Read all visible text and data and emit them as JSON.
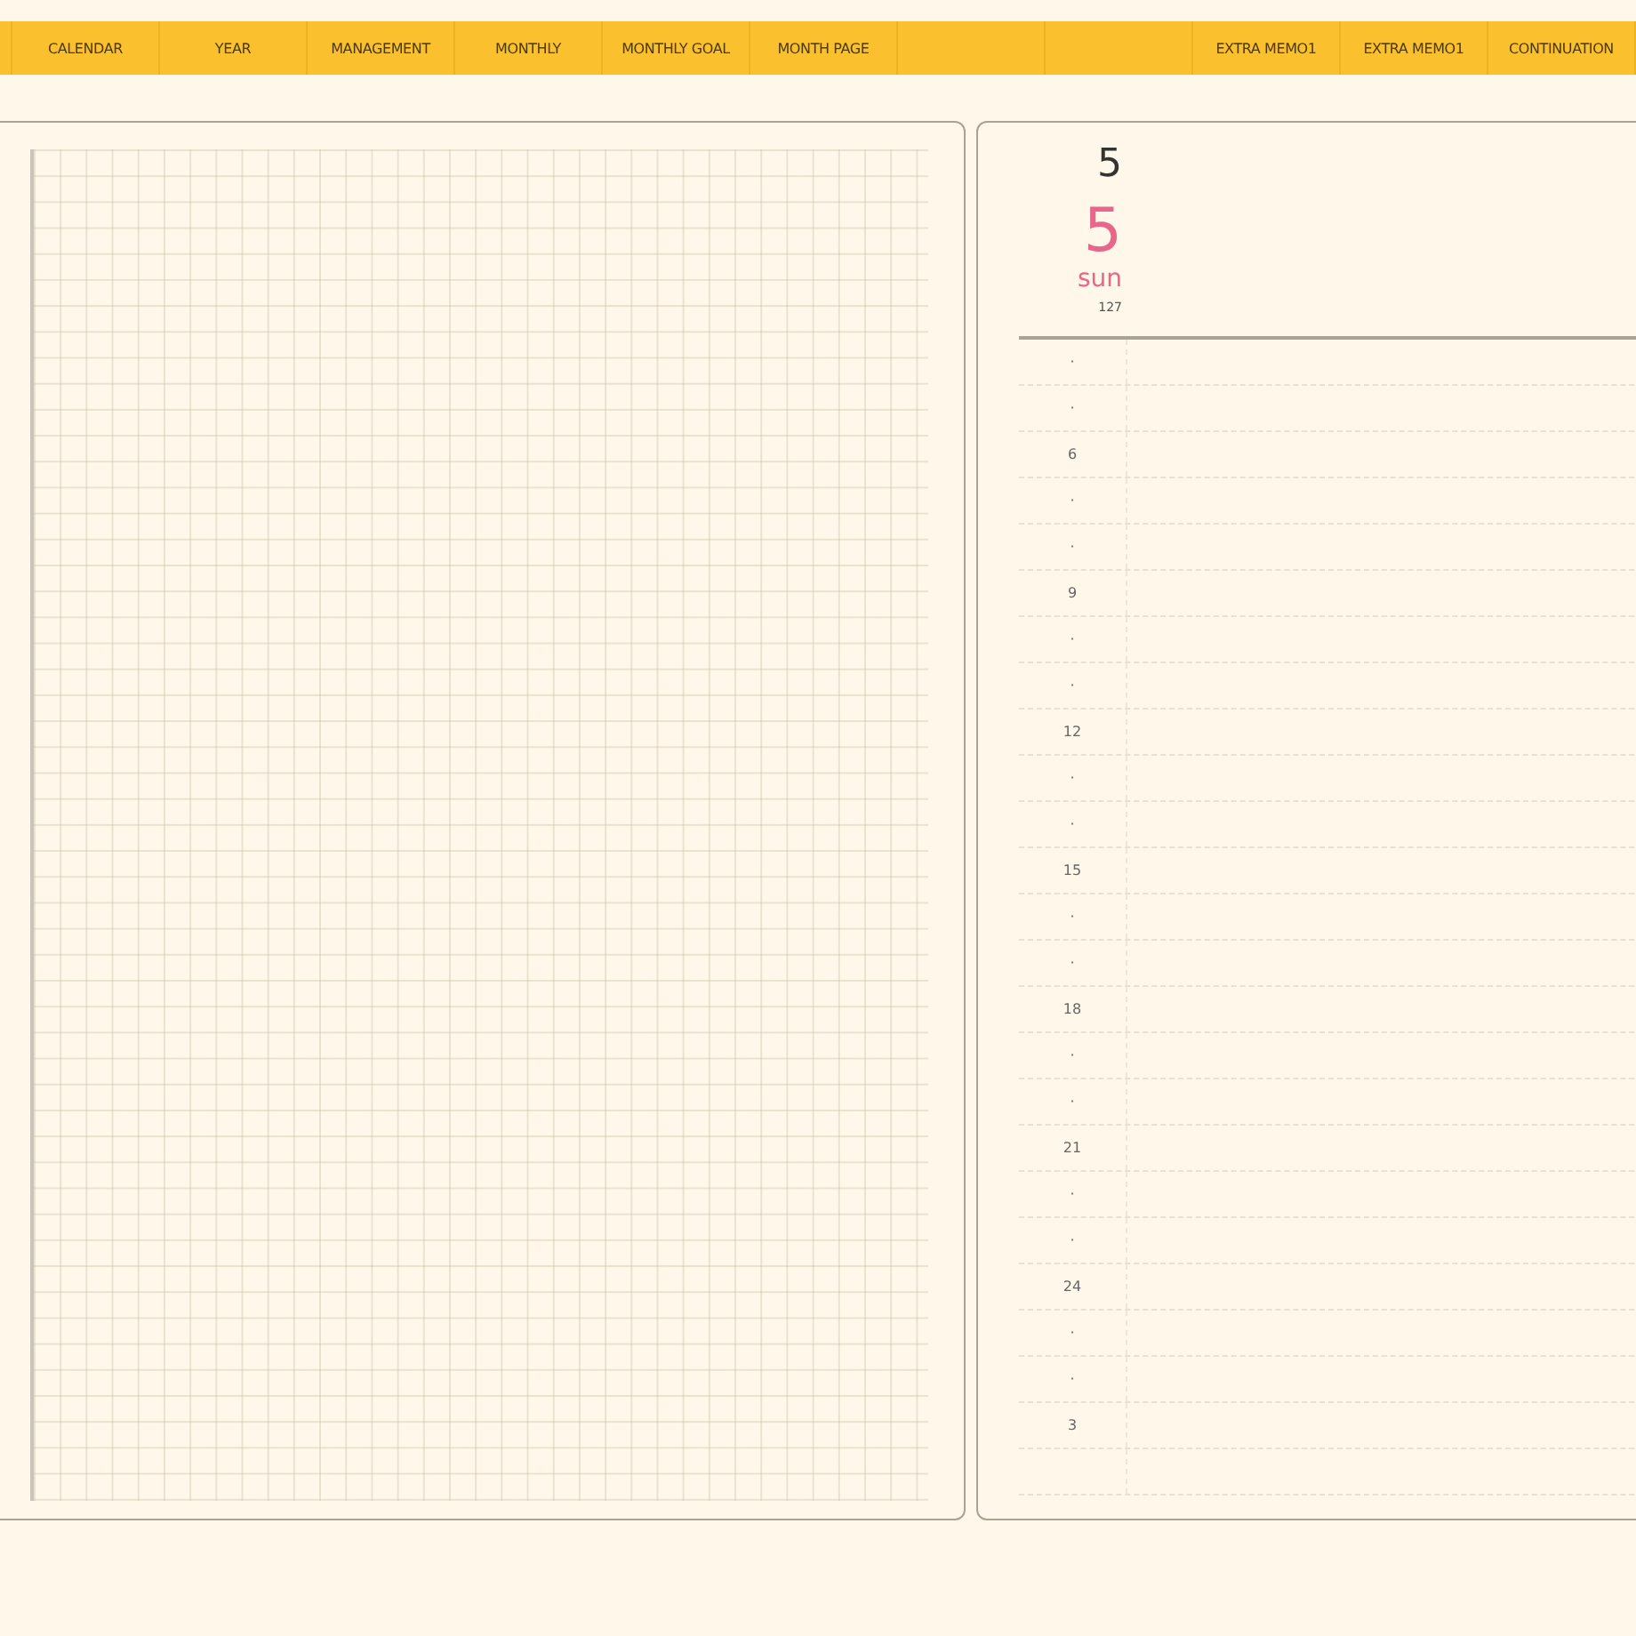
{
  "nav_tabs": [
    {
      "kind": "tab",
      "label": "CALENDAR"
    },
    {
      "kind": "tab",
      "label": "YEAR"
    },
    {
      "kind": "tab",
      "label": "MANAGEMENT"
    },
    {
      "kind": "tab",
      "label": "MONTHLY"
    },
    {
      "kind": "tab",
      "label": "MONTHLY GOAL"
    },
    {
      "kind": "tab",
      "label": "MONTH PAGE"
    },
    {
      "kind": "blank"
    },
    {
      "kind": "blank"
    },
    {
      "kind": "tab",
      "label": "EXTRA MEMO1"
    },
    {
      "kind": "tab",
      "label": "EXTRA MEMO1"
    },
    {
      "kind": "tab",
      "label": "CONTINUATION"
    }
  ],
  "day_page": {
    "month": "5",
    "day": "5",
    "weekday": "sun",
    "day_of_year": "127",
    "hours": [
      "·",
      "·",
      "6",
      "·",
      "·",
      "9",
      "·",
      "·",
      "12",
      "·",
      "·",
      "15",
      "·",
      "·",
      "18",
      "·",
      "·",
      "21",
      "·",
      "·",
      "24",
      "·",
      "·",
      "3"
    ]
  }
}
